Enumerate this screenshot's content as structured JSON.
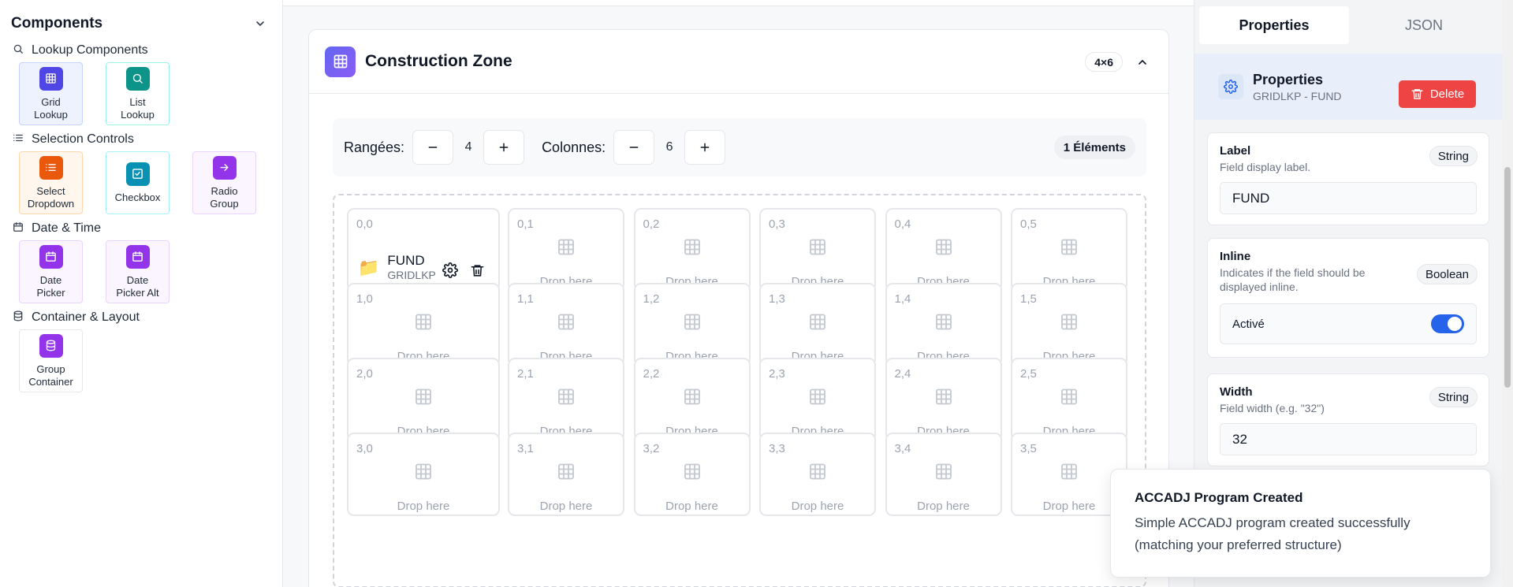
{
  "sidebar": {
    "title": "Components",
    "sections": [
      {
        "title": "Lookup Components",
        "icon": "search-icon",
        "items": [
          {
            "label": "Grid\nLookup",
            "icon": "grid-icon",
            "color": "#4f46e5",
            "bg": "#eef2ff",
            "border": "#c7d2fe"
          },
          {
            "label": "List\nLookup",
            "icon": "search-icon",
            "color": "#0d9488",
            "bg": "#ffffff",
            "border": "#99f6e4"
          }
        ]
      },
      {
        "title": "Selection Controls",
        "icon": "list-icon",
        "items": [
          {
            "label": "Select\nDropdown",
            "icon": "list-icon",
            "color": "#ea580c",
            "bg": "#fff7ed",
            "border": "#fed7aa"
          },
          {
            "label": "Checkbox",
            "icon": "checkbox-icon",
            "color": "#0891b2",
            "bg": "#ffffff",
            "border": "#a5f3fc"
          },
          {
            "label": "Radio\nGroup",
            "icon": "arrow-right-icon",
            "color": "#9333ea",
            "bg": "#faf5ff",
            "border": "#e9d5ff"
          }
        ]
      },
      {
        "title": "Date & Time",
        "icon": "calendar-icon",
        "items": [
          {
            "label": "Date\nPicker",
            "icon": "calendar-icon",
            "color": "#9333ea",
            "bg": "#faf5ff",
            "border": "#e9d5ff"
          },
          {
            "label": "Date\nPicker Alt",
            "icon": "calendar-icon",
            "color": "#9333ea",
            "bg": "#faf5ff",
            "border": "#e9d5ff"
          }
        ]
      },
      {
        "title": "Container & Layout",
        "icon": "database-icon",
        "items": [
          {
            "label": "Group\nContainer",
            "icon": "database-icon",
            "color": "#9333ea",
            "bg": "#ffffff",
            "border": "#e5e7eb"
          }
        ]
      }
    ]
  },
  "zone": {
    "title": "Construction Zone",
    "dimensions": "4×6",
    "rows_label": "Rangées:",
    "rows_value": "4",
    "cols_label": "Colonnes:",
    "cols_value": "6",
    "elements_count": "1 Éléments",
    "drop_text": "Drop here",
    "rows": 4,
    "cols": 6,
    "filled_cell": {
      "coord": "0,0",
      "name": "FUND",
      "type": "GRIDLKP"
    }
  },
  "panel": {
    "tabs": [
      "Properties",
      "JSON"
    ],
    "header_title": "Properties",
    "header_sub": "GRIDLKP - FUND",
    "delete_label": "Delete",
    "label_prop": {
      "name": "Label",
      "desc": "Field display label.",
      "type": "String",
      "value": "FUND"
    },
    "inline_prop": {
      "name": "Inline",
      "desc": "Indicates if the field should be displayed inline.",
      "type": "Boolean",
      "toggle_label": "Activé",
      "on": true
    },
    "width_prop": {
      "name": "Width",
      "desc": "Field width (e.g. \"32\")",
      "type": "String",
      "value": "32"
    }
  },
  "toast": {
    "title": "ACCADJ Program Created",
    "body": "Simple ACCADJ program created successfully (matching your preferred structure)"
  },
  "colors": {
    "accent": "#2563eb",
    "danger": "#ef4444",
    "zone_icon": "#6366f1"
  }
}
